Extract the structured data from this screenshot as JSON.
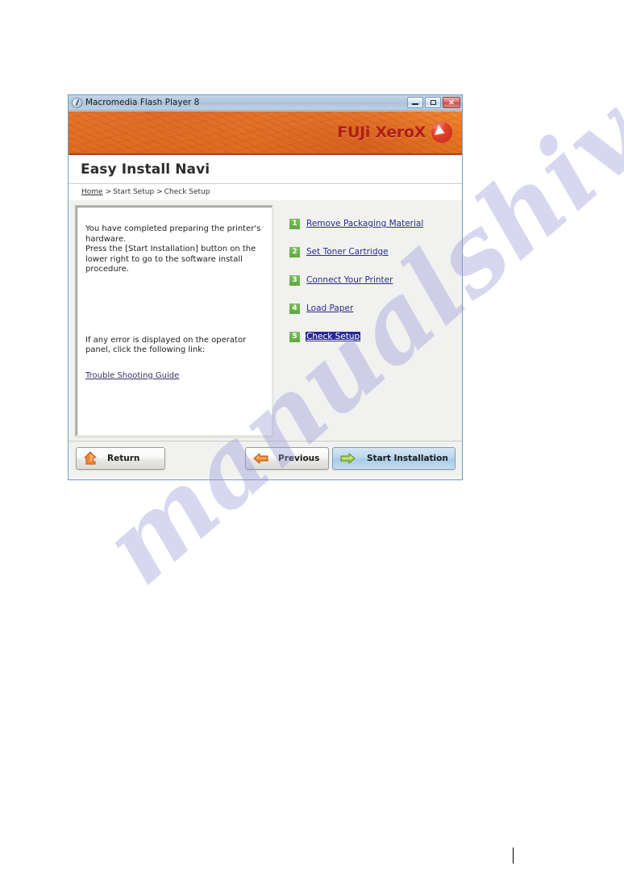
{
  "window": {
    "title": "Macromedia Flash Player 8",
    "icon": "flash-player-icon",
    "controls": {
      "minimize": "minimize-button",
      "maximize": "maximize-button",
      "close_glyph": "✕"
    }
  },
  "banner": {
    "brand": "FUJi XeroX",
    "ball_icon": "xerox-sphere-icon"
  },
  "header": {
    "page_title": "Easy Install Navi"
  },
  "breadcrumb": {
    "home": "Home",
    "separator": ">",
    "level2": "Start Setup",
    "current": "Check Setup"
  },
  "info_panel": {
    "paragraph_main": "You have completed preparing the printer's hardware.\nPress the [Start Installation] button on the lower right to go to the software install procedure.",
    "paragraph_error": "If any error is displayed on the operator panel, click the following link:",
    "trouble_link": "Trouble Shooting Guide"
  },
  "steps": [
    {
      "number": "1",
      "label": "Remove Packaging Material",
      "selected": false
    },
    {
      "number": "2",
      "label": "Set Toner Cartridge",
      "selected": false
    },
    {
      "number": "3",
      "label": "Connect Your Printer",
      "selected": false
    },
    {
      "number": "4",
      "label": "Load Paper",
      "selected": false
    },
    {
      "number": "5",
      "label": "Check Setup",
      "selected": true
    }
  ],
  "footer": {
    "return_label": "Return",
    "return_icon": "arrow-up-return-icon",
    "previous_label": "Previous",
    "previous_icon": "arrow-left-icon",
    "start_label": "Start Installation",
    "start_icon": "arrow-right-icon"
  },
  "watermark": {
    "text": "manualshive.com"
  },
  "colors": {
    "banner_orange": "#ed8128",
    "brand_red": "#b01e17",
    "step_green": "#5ea93f",
    "link_navy": "#2b2b8f",
    "selected_navy": "#28289a",
    "start_button_blue": "#a9cbe8"
  }
}
